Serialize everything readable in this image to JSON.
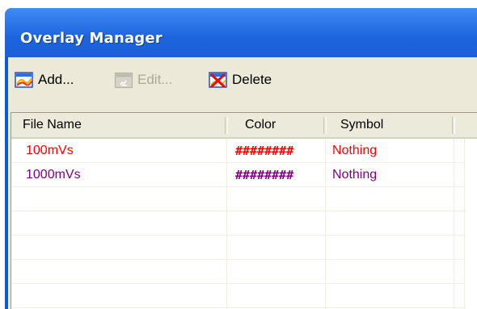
{
  "window": {
    "title": "Overlay Manager"
  },
  "toolbar": {
    "add_label": "Add...",
    "edit_label": "Edit...",
    "delete_label": "Delete"
  },
  "grid": {
    "columns": [
      "File Name",
      "Color",
      "Symbol"
    ],
    "rows": [
      {
        "file_name": "100mVs",
        "color": "########",
        "symbol": "Nothing",
        "text_color": "#ff0000"
      },
      {
        "file_name": "1000mVs",
        "color": "########",
        "symbol": "Nothing",
        "text_color": "#800080"
      }
    ]
  },
  "icons": {
    "add": "add-overlay-icon",
    "edit": "edit-overlay-icon",
    "delete": "delete-overlay-icon"
  }
}
